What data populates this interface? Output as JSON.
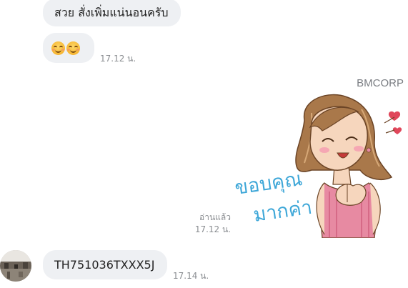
{
  "messages": [
    {
      "text": "สวย สั่งเพิ่มแน่นอนครับ"
    },
    {
      "emojis": [
        "smiling-face-icon",
        "smiling-face-icon"
      ],
      "time": "17.12 น."
    },
    {
      "sender": "BMCORP",
      "sticker_text_line1": "ขอบคุณ",
      "sticker_text_line2": "มากค่า",
      "read_label": "อ่านแล้ว",
      "time": "17.12 น."
    },
    {
      "text": "TH751036TXXX5J",
      "time": "17.14 น."
    }
  ],
  "colors": {
    "bubble_bg": "#eef0f3",
    "sticker_text": "#3ea7d8",
    "meta_text": "#8a8d91"
  }
}
